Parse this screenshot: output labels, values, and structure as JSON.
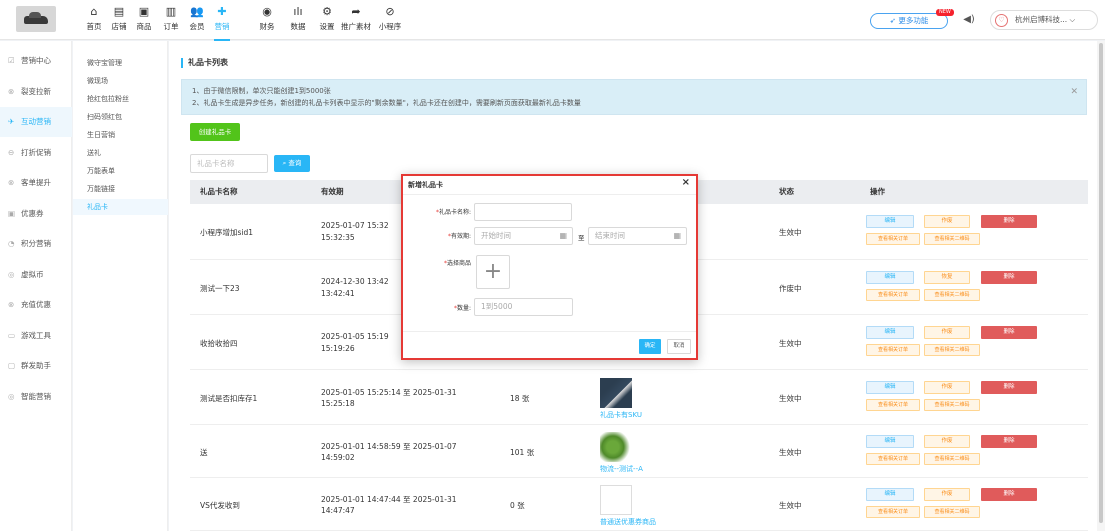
{
  "nav": {
    "items": [
      {
        "label": "首页",
        "icon": "home-icon",
        "glyph": "⌂"
      },
      {
        "label": "店铺",
        "icon": "store-icon",
        "glyph": "▤"
      },
      {
        "label": "商品",
        "icon": "goods-icon",
        "glyph": "▣"
      },
      {
        "label": "订单",
        "icon": "order-icon",
        "glyph": "▥"
      },
      {
        "label": "会员",
        "icon": "member-icon",
        "glyph": "👥"
      },
      {
        "label": "营销",
        "icon": "marketing-icon",
        "glyph": "✚"
      },
      {
        "label": "财务",
        "icon": "finance-icon",
        "glyph": "◉"
      },
      {
        "label": "数据",
        "icon": "data-icon",
        "glyph": "ılı"
      },
      {
        "label": "设置",
        "icon": "settings-icon",
        "glyph": "⚙"
      },
      {
        "label": "推广素材",
        "icon": "share-icon",
        "glyph": "➦"
      },
      {
        "label": "小程序",
        "icon": "miniapp-icon",
        "glyph": "⊘"
      }
    ],
    "active": "营销",
    "more_label": "更多功能",
    "new_badge": "NEW",
    "company": "杭州启博科技...",
    "accent": "#29b6f6"
  },
  "sidebar1": {
    "items": [
      {
        "label": "营销中心",
        "glyph": "☑"
      },
      {
        "label": "裂变拉新",
        "glyph": "⊗"
      },
      {
        "label": "互动营销",
        "glyph": "✈"
      },
      {
        "label": "打折促销",
        "glyph": "⊖"
      },
      {
        "label": "客单提升",
        "glyph": "⊗"
      },
      {
        "label": "优惠券",
        "glyph": "▣"
      },
      {
        "label": "积分营销",
        "glyph": "◔"
      },
      {
        "label": "虚拟币",
        "glyph": "◎"
      },
      {
        "label": "充值优惠",
        "glyph": "⊗"
      },
      {
        "label": "游戏工具",
        "glyph": "▭"
      },
      {
        "label": "群发助手",
        "glyph": "▢"
      },
      {
        "label": "智能营销",
        "glyph": "◎"
      }
    ],
    "active": "互动营销"
  },
  "sidebar2": {
    "items": [
      "微守宝管理",
      "微现场",
      "抢红包拉粉丝",
      "扫码领红包",
      "生日营销",
      "送礼",
      "万能表单",
      "万能链接",
      "礼品卡"
    ],
    "active": "礼品卡"
  },
  "main": {
    "title": "礼品卡列表",
    "notice_lines": [
      "1、由于微信限制，单次只能创建1到5000张",
      "2、礼品卡生成是异步任务，新创建的礼品卡列表中显示的\"剩余数量\"，礼品卡还在创建中，需要刷新页面获取最新礼品卡数量"
    ],
    "create_label": "创建礼品卡",
    "search_placeholder": "礼品卡名称",
    "search_label": "查询"
  },
  "table": {
    "headers": [
      "礼品卡名称",
      "有效期",
      "状态",
      "操作"
    ],
    "rows": [
      {
        "name": "小程序增加sid1",
        "period_l1": "2025-01-07 15:32",
        "period_l2": "15:32:35",
        "count": "",
        "product": "",
        "img": "",
        "status": "生效中",
        "void": "作废"
      },
      {
        "name": "测试一下23",
        "period_l1": "2024-12-30 13:42",
        "period_l2": "13:42:41",
        "count": "",
        "product": "",
        "img": "",
        "status": "作废中",
        "void": "恢复"
      },
      {
        "name": "收拾收拾四",
        "period_l1": "2025-01-05 15:19",
        "period_l2": "15:19:26",
        "count": "",
        "product": "",
        "img": "",
        "status": "生效中",
        "void": "作废"
      },
      {
        "name": "测试是否扣库存1",
        "period_l1": "2025-01-05 15:25:14 至 2025-01-31",
        "period_l2": "15:25:18",
        "count": "18 张",
        "product": "礼品卡有SKU",
        "img": "clothes",
        "status": "生效中",
        "void": "作废"
      },
      {
        "name": "送",
        "period_l1": "2025-01-01 14:58:59 至 2025-01-07",
        "period_l2": "14:59:02",
        "count": "101 张",
        "product": "物流--测试--A",
        "img": "veg",
        "status": "生效中",
        "void": "作废"
      },
      {
        "name": "VS代发收到",
        "period_l1": "2025-01-01 14:47:44 至 2025-01-31",
        "period_l2": "14:47:47",
        "count": "0 张",
        "product": "普通送优惠券商品",
        "img": "broken",
        "status": "生效中",
        "void": "作废"
      }
    ],
    "op_edit": "编辑",
    "op_delete": "删除",
    "op_orders": "查看相关订单",
    "op_qr": "查看相关二维码"
  },
  "modal": {
    "title": "新增礼品卡",
    "name_label": "礼品卡名称:",
    "period_label": "有效期:",
    "start_placeholder": "开始时间",
    "to_label": "至",
    "end_placeholder": "结束时间",
    "goods_label": "选择商品",
    "qty_label": "数量:",
    "qty_placeholder": "1到5000",
    "ok_label": "确定",
    "cancel_label": "取消",
    "border_color": "#e53935"
  }
}
